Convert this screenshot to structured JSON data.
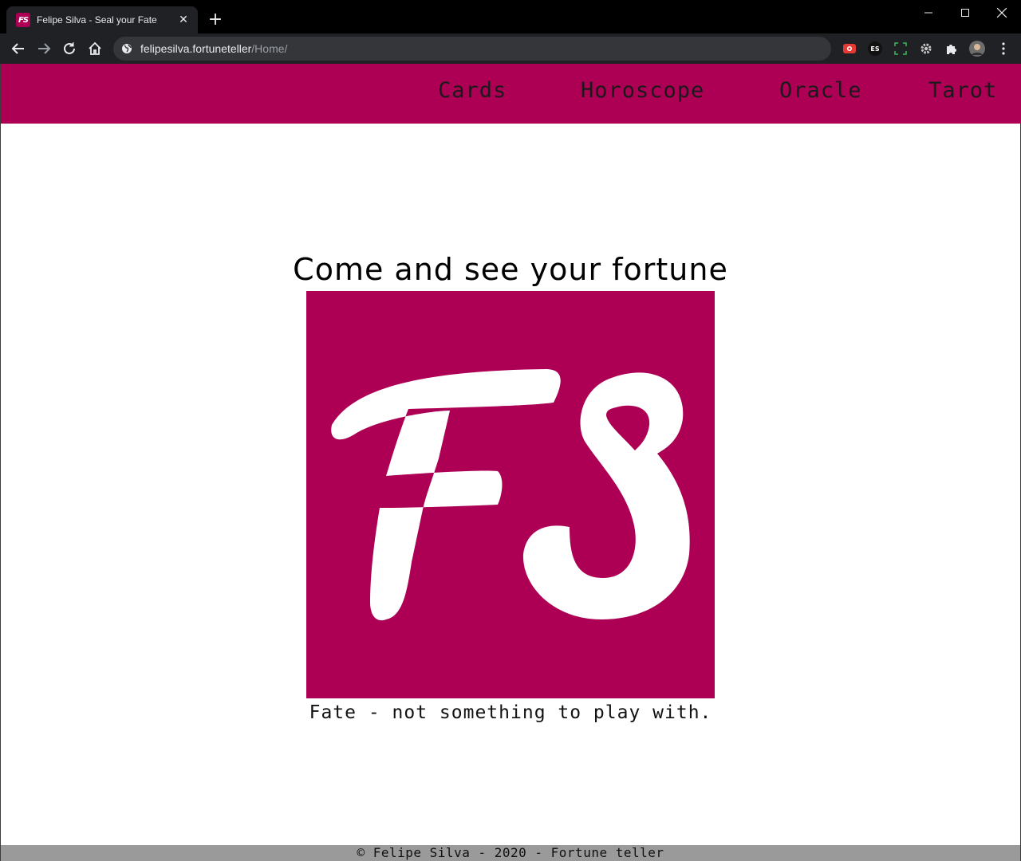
{
  "browser": {
    "tab": {
      "title": "Felipe Silva - Seal your Fate",
      "favicon_text": "FS"
    },
    "address": {
      "host": "felipesilva.fortuneteller",
      "path": "/Home/"
    },
    "extensions": [
      {
        "name": "youtube-icon"
      },
      {
        "name": "es-icon",
        "label": "ES"
      },
      {
        "name": "screenshot-icon"
      },
      {
        "name": "settings-gear-icon"
      },
      {
        "name": "puzzle-icon"
      },
      {
        "name": "avatar"
      }
    ]
  },
  "site": {
    "colors": {
      "brand": "#ad0055",
      "footer_bg": "#9a9a9a"
    },
    "nav": {
      "items": [
        {
          "label": "Cards"
        },
        {
          "label": "Horoscope"
        },
        {
          "label": "Oracle"
        },
        {
          "label": "Tarot"
        }
      ]
    },
    "hero": {
      "title": "Come and see your fortune",
      "logo_text": "FS",
      "tagline": "Fate - not something to play with."
    },
    "footer": {
      "text": "© Felipe Silva - 2020 - Fortune teller"
    }
  }
}
